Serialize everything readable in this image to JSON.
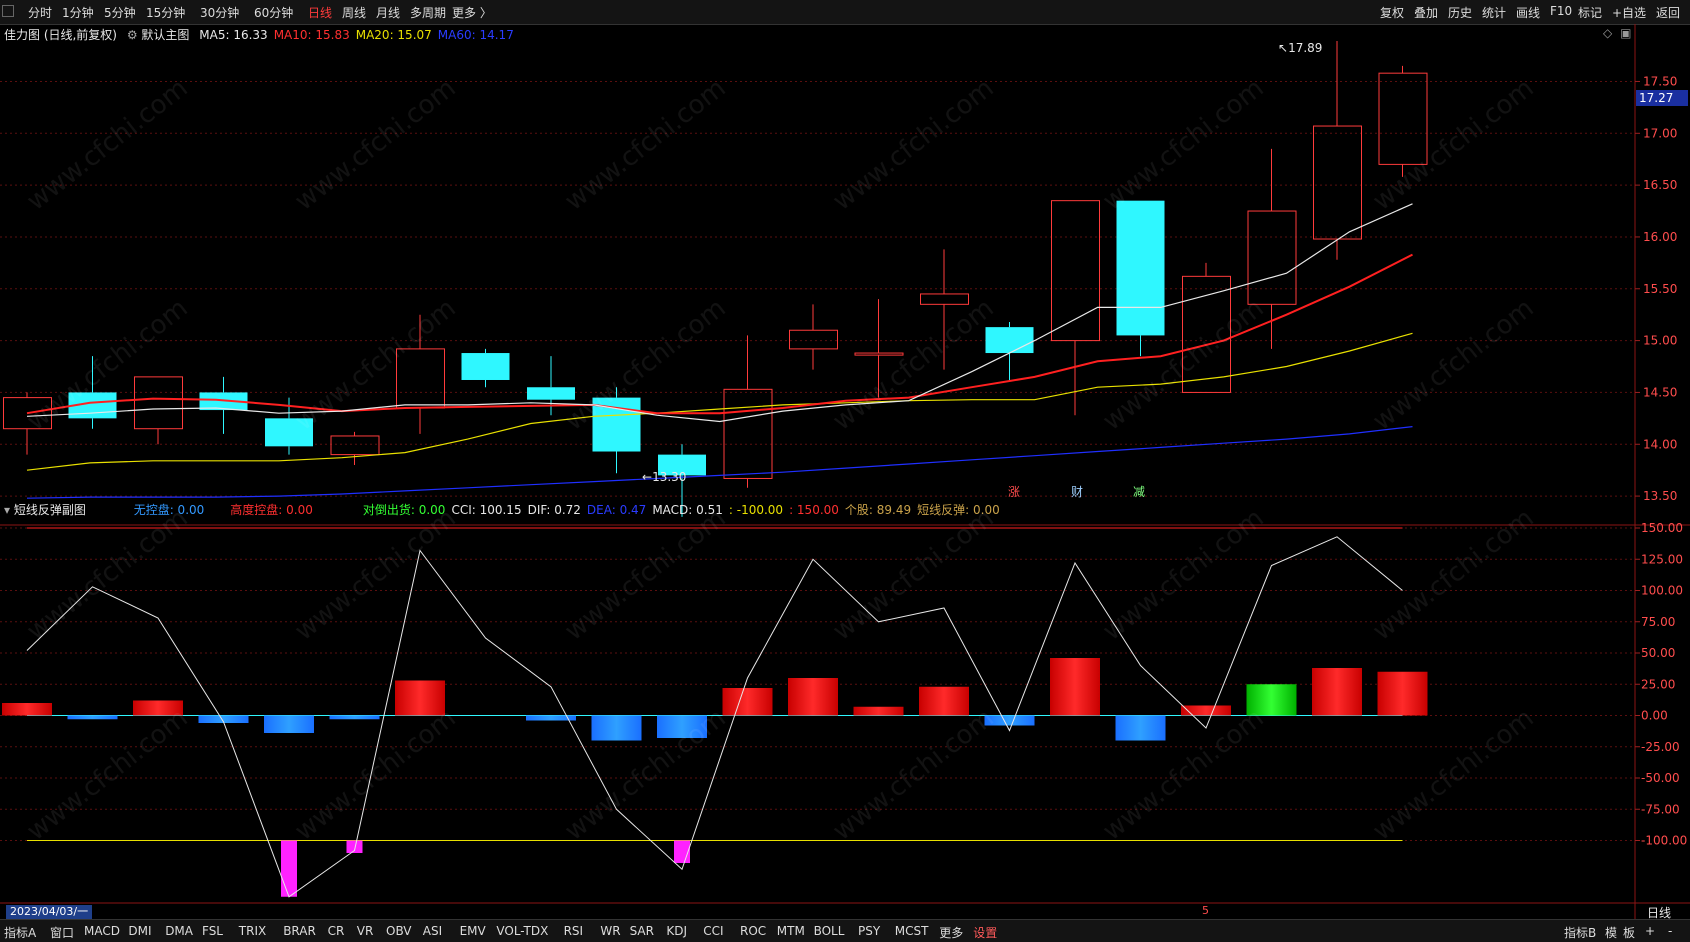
{
  "toolbar": {
    "left_items": [
      "分时",
      "1分钟",
      "5分钟",
      "15分钟",
      "30分钟",
      "60分钟",
      "日线",
      "周线",
      "月线",
      "多周期",
      "更多 〉"
    ],
    "active_index": 6,
    "right_items": [
      "复权",
      "叠加",
      "历史",
      "统计",
      "画线",
      "F10",
      "标记",
      "+自选",
      "返回"
    ]
  },
  "main_chart": {
    "title": "佳力图 (日线,前复权)",
    "template": "默认主图",
    "ma_legend": [
      {
        "label": "MA5: 16.33",
        "color": "#e8e8e8"
      },
      {
        "label": "MA10: 15.83",
        "color": "#ff3030"
      },
      {
        "label": "MA20: 15.07",
        "color": "#e8e000"
      },
      {
        "label": "MA60: 14.17",
        "color": "#2a3cff"
      }
    ],
    "price_ticks": [
      "17.50",
      "17.00",
      "16.50",
      "16.00",
      "15.50",
      "15.00",
      "14.50",
      "14.00",
      "13.50"
    ],
    "last_price": "17.27",
    "high_label": "17.89",
    "low_label": "13.30",
    "event_tags": [
      {
        "text": "涨",
        "color": "#ff4d4d"
      },
      {
        "text": "财",
        "color": "#9fd0ff"
      },
      {
        "text": "减",
        "color": "#7fff7f"
      }
    ]
  },
  "sub_chart": {
    "title": "短线反弹副图",
    "legend": [
      {
        "label": "无控盘: 0.00",
        "color": "#3399ff"
      },
      {
        "label": "高度控盘: 0.00",
        "color": "#ff3030"
      },
      {
        "label": "对倒出货: 0.00",
        "color": "#33ff33"
      },
      {
        "label": "CCI: 100.15",
        "color": "#e8e8e8"
      },
      {
        "label": "DIF: 0.72",
        "color": "#e8e8e8"
      },
      {
        "label": "DEA: 0.47",
        "color": "#2a3cff"
      },
      {
        "label": "MACD: 0.51",
        "color": "#e8e8e8"
      },
      {
        "label": ": -100.00",
        "color": "#e8e000"
      },
      {
        "label": ": 150.00",
        "color": "#ff3030"
      },
      {
        "label": "个股: 89.49",
        "color": "#c9a24a"
      },
      {
        "label": "短线反弹: 0.00",
        "color": "#c9a24a"
      }
    ],
    "ticks": [
      "150.00",
      "125.00",
      "100.00",
      "75.00",
      "50.00",
      "25.00",
      "0.00",
      "-25.00",
      "-50.00",
      "-75.00",
      "-100.00"
    ]
  },
  "date_label": "2023/04/03/一",
  "axis_marker": "5",
  "period_label": "日线",
  "watermark": "www.cfchi.com",
  "bottom_tabs": [
    "指标A",
    "窗口",
    "MACD",
    "DMI",
    "DMA",
    "FSL",
    "TRIX",
    "BRAR",
    "CR",
    "VR",
    "OBV",
    "ASI",
    "EMV",
    "VOL-TDX",
    "RSI",
    "WR",
    "SAR",
    "KDJ",
    "CCI",
    "ROC",
    "MTM",
    "BOLL",
    "PSY",
    "MCST",
    "更多",
    "设置"
  ],
  "bottom_right": [
    "指标B",
    "模",
    "板",
    "+",
    "-"
  ],
  "colors": {
    "up": "#ff3b3b",
    "down": "#2ff7ff",
    "ma5": "#e8e8e8",
    "ma10": "#ff2020",
    "ma20": "#e8e000",
    "ma60": "#1f2fff"
  },
  "chart_data": {
    "type": "candlestick",
    "ylim": [
      13.25,
      17.9
    ],
    "candles": [
      {
        "o": 14.15,
        "h": 14.5,
        "l": 13.9,
        "c": 14.45
      },
      {
        "o": 14.5,
        "h": 14.85,
        "l": 14.15,
        "c": 14.25
      },
      {
        "o": 14.15,
        "h": 14.65,
        "l": 14.0,
        "c": 14.65
      },
      {
        "o": 14.5,
        "h": 14.65,
        "l": 14.1,
        "c": 14.33
      },
      {
        "o": 14.25,
        "h": 14.45,
        "l": 13.9,
        "c": 13.98
      },
      {
        "o": 13.9,
        "h": 14.12,
        "l": 13.8,
        "c": 14.08
      },
      {
        "o": 14.35,
        "h": 15.25,
        "l": 14.1,
        "c": 14.92
      },
      {
        "o": 14.88,
        "h": 14.92,
        "l": 14.55,
        "c": 14.62
      },
      {
        "o": 14.55,
        "h": 14.85,
        "l": 14.28,
        "c": 14.43
      },
      {
        "o": 14.45,
        "h": 14.55,
        "l": 13.72,
        "c": 13.93
      },
      {
        "o": 13.9,
        "h": 14.0,
        "l": 13.3,
        "c": 13.7
      },
      {
        "o": 13.67,
        "h": 15.05,
        "l": 13.58,
        "c": 14.53
      },
      {
        "o": 14.92,
        "h": 15.35,
        "l": 14.72,
        "c": 15.1
      },
      {
        "o": 14.86,
        "h": 15.4,
        "l": 14.45,
        "c": 14.88
      },
      {
        "o": 15.35,
        "h": 15.88,
        "l": 14.72,
        "c": 15.45
      },
      {
        "o": 15.13,
        "h": 15.18,
        "l": 14.62,
        "c": 14.88
      },
      {
        "o": 15.0,
        "h": 16.35,
        "l": 14.28,
        "c": 16.35
      },
      {
        "o": 16.35,
        "h": 16.35,
        "l": 14.85,
        "c": 15.05
      },
      {
        "o": 14.5,
        "h": 15.75,
        "l": 14.5,
        "c": 15.62
      },
      {
        "o": 15.35,
        "h": 16.85,
        "l": 14.92,
        "c": 16.25
      },
      {
        "o": 15.98,
        "h": 17.89,
        "l": 15.78,
        "c": 17.07
      },
      {
        "o": 16.7,
        "h": 17.65,
        "l": 16.58,
        "c": 17.58
      }
    ],
    "ma5": [
      14.27,
      14.3,
      14.34,
      14.35,
      14.3,
      14.32,
      14.38,
      14.38,
      14.4,
      14.38,
      14.28,
      14.22,
      14.32,
      14.38,
      14.42,
      14.7,
      15.0,
      15.32,
      15.32,
      15.48,
      15.65,
      16.05,
      16.32
    ],
    "ma10": [
      14.3,
      14.4,
      14.44,
      14.43,
      14.38,
      14.32,
      14.35,
      14.36,
      14.37,
      14.38,
      14.3,
      14.3,
      14.35,
      14.42,
      14.45,
      14.55,
      14.65,
      14.8,
      14.85,
      15.0,
      15.25,
      15.52,
      15.83
    ],
    "ma20": [
      13.75,
      13.82,
      13.84,
      13.84,
      13.84,
      13.87,
      13.92,
      14.05,
      14.2,
      14.27,
      14.3,
      14.34,
      14.38,
      14.4,
      14.42,
      14.43,
      14.43,
      14.55,
      14.58,
      14.65,
      14.75,
      14.9,
      15.07
    ],
    "ma60": [
      13.48,
      13.49,
      13.49,
      13.49,
      13.5,
      13.52,
      13.55,
      13.58,
      13.61,
      13.64,
      13.67,
      13.7,
      13.73,
      13.77,
      13.81,
      13.85,
      13.89,
      13.93,
      13.97,
      14.01,
      14.05,
      14.1,
      14.17
    ],
    "sub_ylim": [
      -150,
      150
    ],
    "cci": [
      52,
      103,
      78,
      -5,
      -145,
      -108,
      132,
      62,
      23,
      -75,
      -123,
      30,
      125,
      75,
      86,
      -12,
      122,
      40,
      -10,
      120,
      143,
      100
    ],
    "bars": [
      {
        "v": 10,
        "c": "red"
      },
      {
        "v": -3,
        "c": "blue"
      },
      {
        "v": 12,
        "c": "red"
      },
      {
        "v": -6,
        "c": "blue"
      },
      {
        "v": -14,
        "c": "blue"
      },
      {
        "v": -3,
        "c": "blue"
      },
      {
        "v": 28,
        "c": "red"
      },
      {
        "v": 0,
        "c": "none"
      },
      {
        "v": -4,
        "c": "blue"
      },
      {
        "v": -20,
        "c": "blue"
      },
      {
        "v": -18,
        "c": "blue"
      },
      {
        "v": 22,
        "c": "red"
      },
      {
        "v": 30,
        "c": "red"
      },
      {
        "v": 7,
        "c": "red"
      },
      {
        "v": 23,
        "c": "red"
      },
      {
        "v": -8,
        "c": "blue"
      },
      {
        "v": 46,
        "c": "red"
      },
      {
        "v": -20,
        "c": "blue"
      },
      {
        "v": 8,
        "c": "red"
      },
      {
        "v": 25,
        "c": "green"
      },
      {
        "v": 38,
        "c": "red"
      },
      {
        "v": 35,
        "c": "red"
      }
    ],
    "magenta_bars": [
      {
        "i": 4,
        "top": -100,
        "bottom": -145
      },
      {
        "i": 5,
        "top": -100,
        "bottom": -110
      },
      {
        "i": 10,
        "top": -100,
        "bottom": -118
      }
    ],
    "ref_lines": [
      150,
      0,
      -100
    ]
  }
}
